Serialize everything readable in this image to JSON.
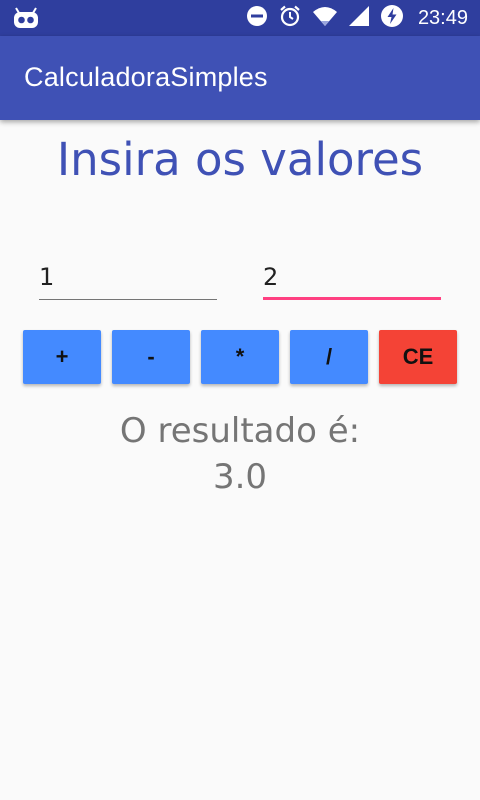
{
  "status_bar": {
    "time": "23:49",
    "icons": [
      "app-robot-icon",
      "do-not-disturb-icon",
      "alarm-icon",
      "wifi-icon",
      "signal-icon",
      "battery-charging-icon"
    ]
  },
  "app_bar": {
    "title": "CalculadoraSimples"
  },
  "main": {
    "heading": "Insira os valores",
    "input_1": {
      "value": "1"
    },
    "input_2": {
      "value": "2"
    },
    "buttons": {
      "add": "+",
      "subtract": "-",
      "multiply": "*",
      "divide": "/",
      "clear": "CE"
    },
    "result_label": "O resultado é:",
    "result_value": "3.0"
  },
  "colors": {
    "status_bar": "#2f3e9e",
    "app_bar": "#3f51b5",
    "heading": "#3f51b5",
    "accent": "#ff4081",
    "button_op": "#448aff",
    "button_ce": "#f44336",
    "result_text": "#757575"
  }
}
